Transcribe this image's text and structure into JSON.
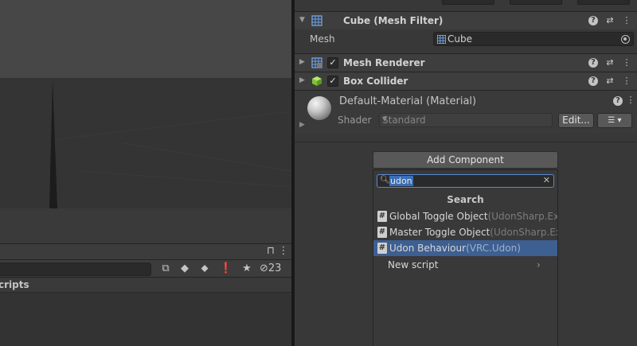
{
  "inspector": {
    "mesh_filter": {
      "title": "Cube (Mesh Filter)",
      "mesh_label": "Mesh",
      "mesh_value": "Cube"
    },
    "mesh_renderer": {
      "title": "Mesh Renderer"
    },
    "box_collider": {
      "title": "Box Collider"
    },
    "material": {
      "title": "Default-Material (Material)",
      "shader_label": "Shader",
      "shader_value": "Standard",
      "edit_label": "Edit...",
      "list_label": "☰ ▾"
    },
    "add_component": {
      "button_label": "Add Component",
      "search_value": "udon",
      "section_title": "Search",
      "items": [
        {
          "name": "Global Toggle Object",
          "namespace": "(UdonSharp.Exa"
        },
        {
          "name": "Master Toggle Object",
          "namespace": "(UdonSharp.Ex"
        },
        {
          "name": "Udon Behaviour",
          "namespace": "(VRC.Udon)"
        },
        {
          "name": "New script",
          "namespace": ""
        }
      ]
    }
  },
  "project": {
    "hidden_count": "23",
    "folder_label": "cripts"
  },
  "colors": {
    "selection": "#3d5f91",
    "search_focus": "#5a8ad0",
    "background": "#383838"
  }
}
